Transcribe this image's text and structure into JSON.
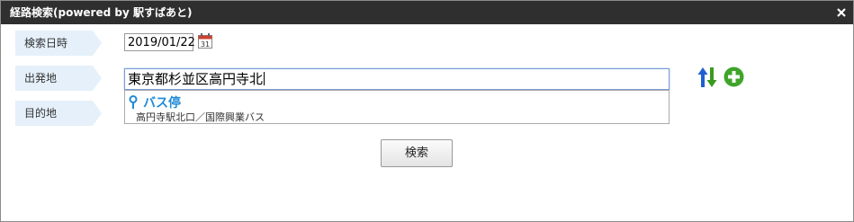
{
  "dialog": {
    "title": "経路検索(powered by 駅すぱあと)"
  },
  "form": {
    "date_label": "検索日時",
    "date_value": "2019/01/22",
    "calendar_day": "31",
    "from_label": "出発地",
    "from_value": "東京都杉並区高円寺北",
    "to_label": "目的地",
    "to_value": ""
  },
  "suggestions": {
    "category": "バス停",
    "items": [
      "高円寺駅北口／国際興業バス"
    ]
  },
  "buttons": {
    "search_label": "検索"
  },
  "colors": {
    "titlebar": "#2f2f2f",
    "label_bg": "#e5f0fa",
    "suggest_category": "#1f8ad6",
    "swap_up": "#1f5fd0",
    "swap_down": "#3a9a1f",
    "add": "#3fa52a"
  },
  "icons": {
    "close": "close-icon",
    "calendar": "calendar-icon",
    "pin": "map-pin-icon",
    "swap": "swap-arrows-icon",
    "add": "add-circle-icon"
  }
}
